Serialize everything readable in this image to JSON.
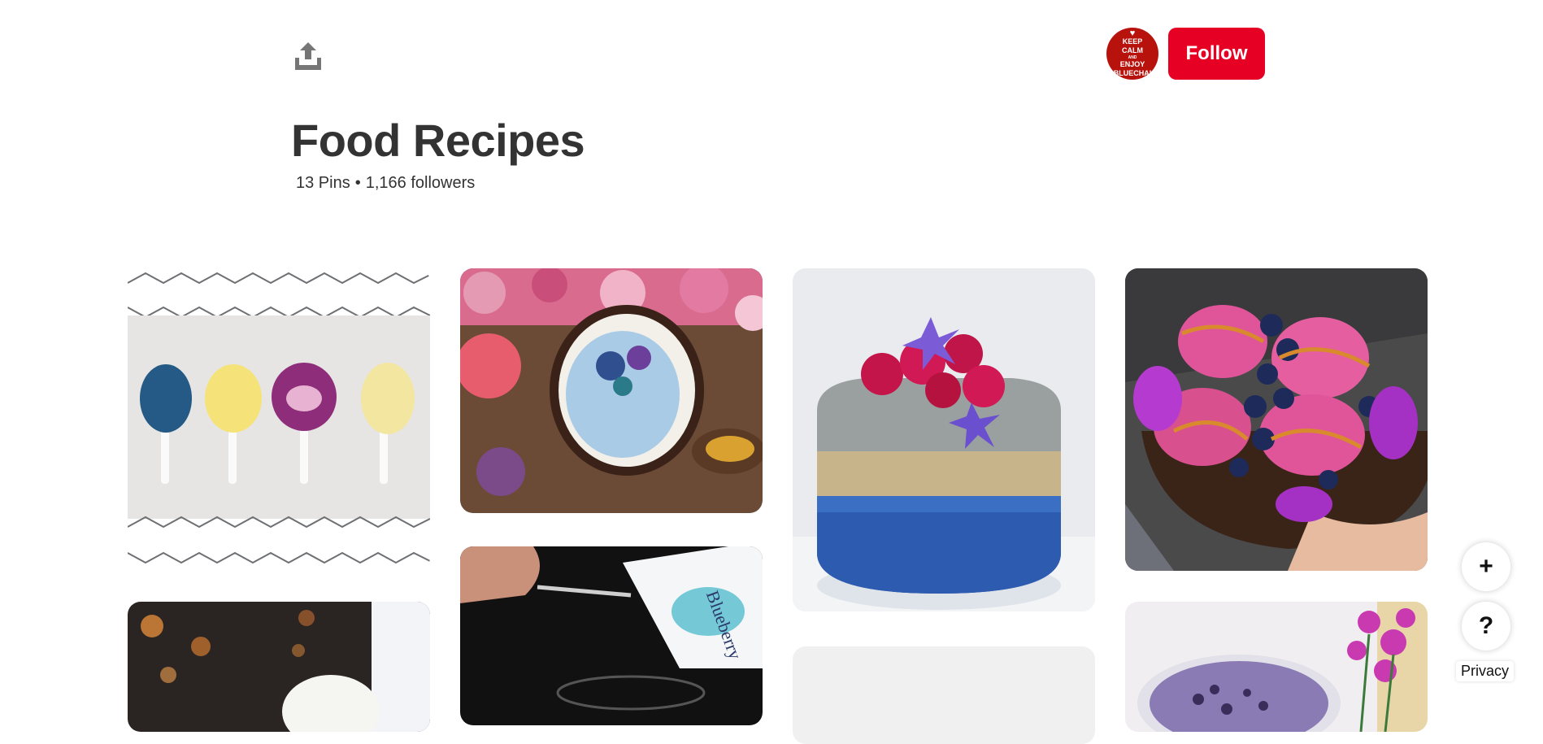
{
  "header": {
    "share_icon": "share-upload-icon",
    "avatar_text": [
      "KEEP",
      "CALM",
      "AND",
      "ENJOY",
      "BLUECHAI"
    ],
    "follow_label": "Follow"
  },
  "board": {
    "title": "Food Recipes",
    "pins": "13 Pins",
    "separator": "•",
    "followers": "1,166 followers"
  },
  "pins": [
    {
      "subject": "animal-face popsicles on marble"
    },
    {
      "subject": "coconut bowl with flowers"
    },
    {
      "subject": "layered blue chia pudding with raspberries"
    },
    {
      "subject": "pink nice cream bowl with blueberries"
    },
    {
      "subject": "coconut dessert with bokeh lights"
    },
    {
      "subject": "blueberry powder being spooned"
    },
    {
      "subject": "loading placeholder"
    },
    {
      "subject": "purple smoothie with flowers"
    }
  ],
  "floating": {
    "add_label": "+",
    "help_label": "?",
    "privacy_label": "Privacy"
  },
  "colors": {
    "follow_button": "#e60023",
    "avatar_bg": "#b8120d",
    "text": "#333333"
  }
}
